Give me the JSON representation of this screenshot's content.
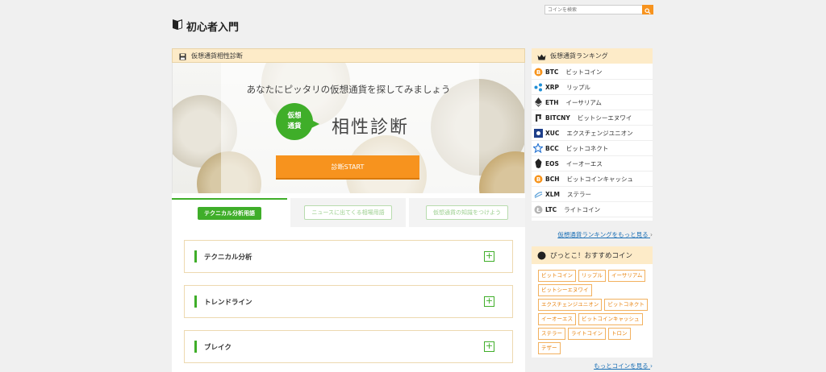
{
  "header": {
    "logo_text": "初心者入門",
    "search_placeholder": "コインを検索"
  },
  "diagnosis": {
    "heading": "仮想通貨相性診断",
    "subtitle": "あなたにピッタリの仮想通貨を探してみましょう",
    "badge_line1": "仮想",
    "badge_line2": "通貨",
    "title": "相性診断",
    "start_label": "診断START"
  },
  "tabs": [
    {
      "label": "テクニカル分析用語",
      "active": true
    },
    {
      "label": "ニュースに出てくる相場用語",
      "active": false
    },
    {
      "label": "仮想通貨の知識をつけよう",
      "active": false
    }
  ],
  "accordion": [
    {
      "label": "テクニカル分析",
      "toggle": "+"
    },
    {
      "label": "トレンドライン",
      "toggle": "+"
    },
    {
      "label": "ブレイク",
      "toggle": "+"
    }
  ],
  "ranking": {
    "heading": "仮想通貨ランキング",
    "items": [
      {
        "symbol": "BTC",
        "name": "ビットコイン",
        "icon": "btc-icon",
        "color": "#f7931a"
      },
      {
        "symbol": "XRP",
        "name": "リップル",
        "icon": "xrp-icon",
        "color": "#1f8fd6"
      },
      {
        "symbol": "ETH",
        "name": "イーサリアム",
        "icon": "eth-icon",
        "color": "#333333"
      },
      {
        "symbol": "BITCNY",
        "name": "ビットシーエヌワイ",
        "icon": "bitcny-icon",
        "color": "#333333"
      },
      {
        "symbol": "XUC",
        "name": "エクスチェンジユニオン",
        "icon": "xuc-icon",
        "color": "#1e3f8a"
      },
      {
        "symbol": "BCC",
        "name": "ビットコネクト",
        "icon": "bcc-icon",
        "color": "#2b77d3"
      },
      {
        "symbol": "EOS",
        "name": "イーオーエス",
        "icon": "eos-icon",
        "color": "#222222"
      },
      {
        "symbol": "BCH",
        "name": "ビットコインキャッシュ",
        "icon": "bch-icon",
        "color": "#f7931a"
      },
      {
        "symbol": "XLM",
        "name": "ステラー",
        "icon": "xlm-icon",
        "color": "#5aa0d8"
      },
      {
        "symbol": "LTC",
        "name": "ライトコイン",
        "icon": "ltc-icon",
        "color": "#a8a8a8"
      }
    ],
    "more_link": "仮想通貨ランキングをもっと見る"
  },
  "recommended": {
    "heading": "ぴっとこ！おすすめコイン",
    "tags": [
      "ビットコイン",
      "リップル",
      "イーサリアム",
      "ビットシーエヌワイ",
      "エクスチェンジユニオン",
      "ビットコネクト",
      "イーオーエス",
      "ビットコインキャッシュ",
      "ステラー",
      "ライトコイン",
      "トロン",
      "テザー"
    ],
    "more_link": "もっとコインを見る"
  },
  "colors": {
    "accent_green": "#3fae29",
    "accent_orange": "#f7931e",
    "header_tan": "#fdebc8",
    "link_blue": "#1a6fb5"
  }
}
